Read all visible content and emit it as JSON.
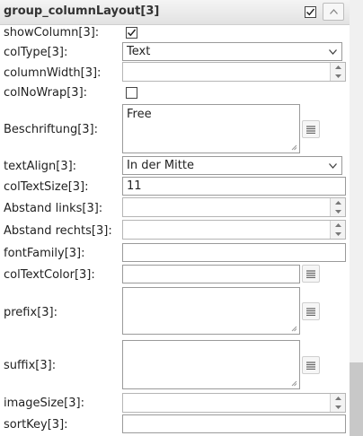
{
  "header": {
    "title": "group_columnLayout[3]",
    "checked": true,
    "collapse_icon": "chevron-up-icon"
  },
  "fields": {
    "showColumn": {
      "label": "showColumn[3]:",
      "checked": true
    },
    "colType": {
      "label": "colType[3]:",
      "value": "Text"
    },
    "columnWidth": {
      "label": "columnWidth[3]:",
      "value": ""
    },
    "colNoWrap": {
      "label": "colNoWrap[3]:",
      "checked": false
    },
    "beschriftung": {
      "label": "Beschriftung[3]:",
      "value": "Free",
      "button_icon": "list-icon"
    },
    "textAlign": {
      "label": "textAlign[3]:",
      "value": "In der Mitte"
    },
    "colTextSize": {
      "label": "colTextSize[3]:",
      "value": "11"
    },
    "abstandLinks": {
      "label": "Abstand links[3]:",
      "value": ""
    },
    "abstandRechts": {
      "label": "Abstand rechts[3]:",
      "value": ""
    },
    "fontFamily": {
      "label": "fontFamily[3]:",
      "value": ""
    },
    "colTextColor": {
      "label": "colTextColor[3]:",
      "value": "",
      "button_icon": "list-icon"
    },
    "prefix": {
      "label": "prefix[3]:",
      "value": "",
      "button_icon": "list-icon"
    },
    "suffix": {
      "label": "suffix[3]:",
      "value": "",
      "button_icon": "list-icon"
    },
    "imageSize": {
      "label": "imageSize[3]:",
      "value": ""
    },
    "sortKey": {
      "label": "sortKey[3]:",
      "value": ""
    }
  },
  "colors": {
    "header_bg": "#e6e6e6",
    "border": "#9a9a9a",
    "scroll_thumb": "#c8c8c8"
  }
}
